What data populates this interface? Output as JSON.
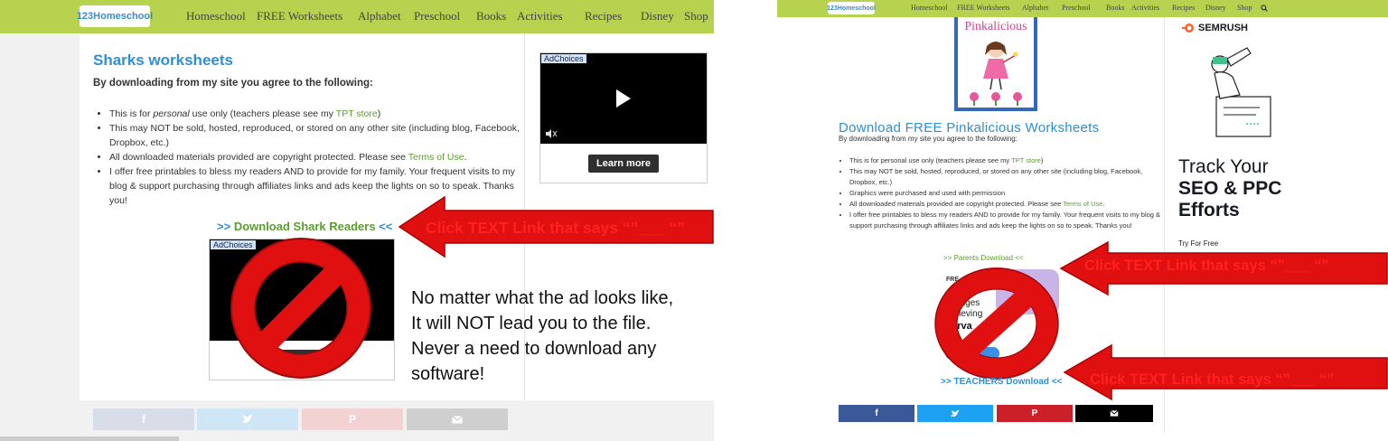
{
  "nav": {
    "logo": "123Homeschool",
    "items": [
      "Homeschool",
      "FREE Worksheets",
      "Alphabet",
      "Preschool",
      "Books",
      "Activities",
      "Recipes",
      "Disney",
      "Shop"
    ]
  },
  "left": {
    "title": "Sharks worksheets",
    "intro": "By downloading from my site you agree to the following:",
    "terms": [
      {
        "pre": "This is for ",
        "em": "personal",
        "post": " use only (teachers please see my ",
        "link": "TPT store",
        "tail": ")"
      },
      {
        "pre": "This may NOT be sold, hosted, reproduced, or stored on any other site (including blog, Facebook, Dropbox, etc.)"
      },
      {
        "pre": "All downloaded materials provided are copyright protected. Please see ",
        "link": "Terms of Use",
        "tail": "."
      },
      {
        "pre": "I offer free printables to bless my readers AND to provide for my family. Your frequent visits to my blog & support purchasing through affiliates links and ads keep the lights on so to speak. Thanks you!"
      }
    ],
    "download_link": {
      "pre": ">>",
      "label": "Download Shark Readers",
      "post": "<<"
    },
    "ad_choices": "AdChoices",
    "learn_more": "Learn more",
    "callout": "Click TEXT Link that says “”___ “”",
    "note": [
      "No matter what the ad looks like,",
      "It will NOT lead you to the file.",
      "Never a need to download any",
      "software!"
    ]
  },
  "right": {
    "book_title": "Pinkalicious",
    "title": "Download FREE Pinkalicious Worksheets",
    "intro": "By downloading from my site you agree to the following:",
    "terms": [
      {
        "pre": "This is for personal use only (teachers please see my ",
        "link": "TPT store",
        "tail": ")"
      },
      {
        "pre": "This may NOT be sold, hosted, reproduced, or stored on any other site (including blog, Facebook, Dropbox, etc.)"
      },
      {
        "pre": "Graphics were purchased and used with permission"
      },
      {
        "pre": "All downloaded materials provided are copyright protected. Please see ",
        "link": "Terms of Use",
        "tail": "."
      },
      {
        "pre": "I offer free printables to bless my readers AND to provide for my family. Your frequent visits to my blog & support purchasing through affiliates links and ads keep the lights on so to speak. Thanks you!"
      }
    ],
    "parents_link": {
      "pre": ">>",
      "label": "Parents Download",
      "post": "<<"
    },
    "teachers_link": {
      "pre": ">>",
      "label": "TEACHERS Download",
      "post": "<<"
    },
    "ad_fragment": [
      "FRE",
      "allenges",
      "achieving",
      "serva"
    ],
    "semrush": {
      "brand": "SEMRUSH",
      "line1": "Track Your",
      "line2": "SEO & PPC",
      "line3": "Efforts",
      "cta": "Try For Free"
    },
    "callout_1": "Click TEXT Link that says “”___ “”",
    "callout_2": "Click TEXT Link that says “”___ “”"
  },
  "colors": {
    "nav": "#b7d24f",
    "title_blue": "#2e8fd6",
    "link_green": "#5a9e2f",
    "arrow_red": "#e01010",
    "facebook": "#3b5998",
    "twitter": "#1da1f2",
    "pinterest": "#cb2027",
    "email": "#000000"
  }
}
